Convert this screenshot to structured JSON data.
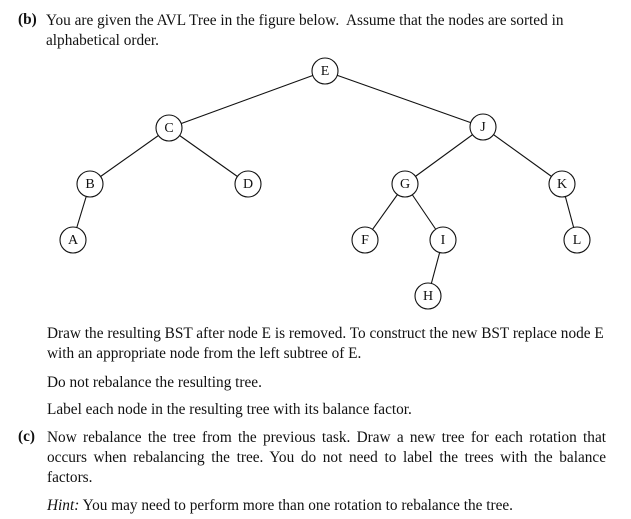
{
  "part_b": {
    "label": "(b)",
    "intro_line1": "You are given the AVL Tree in the figure below.  Assume that the nodes are sorted in",
    "intro_line2": "alphabetical order.",
    "instruction1": "Draw the resulting BST after node E is removed. To construct the new BST replace node E with an appropriate node from the left subtree of E.",
    "instruction2": "Do not rebalance the resulting tree.",
    "instruction3": "Label each node in the resulting tree with its balance factor."
  },
  "tree": {
    "nodes": [
      {
        "id": "E",
        "label": "E"
      },
      {
        "id": "C",
        "label": "C"
      },
      {
        "id": "J",
        "label": "J"
      },
      {
        "id": "B",
        "label": "B"
      },
      {
        "id": "D",
        "label": "D"
      },
      {
        "id": "G",
        "label": "G"
      },
      {
        "id": "K",
        "label": "K"
      },
      {
        "id": "A",
        "label": "A"
      },
      {
        "id": "F",
        "label": "F"
      },
      {
        "id": "I",
        "label": "I"
      },
      {
        "id": "L",
        "label": "L"
      },
      {
        "id": "H",
        "label": "H"
      }
    ],
    "edges": [
      [
        "E",
        "C"
      ],
      [
        "E",
        "J"
      ],
      [
        "C",
        "B"
      ],
      [
        "C",
        "D"
      ],
      [
        "B",
        "A"
      ],
      [
        "J",
        "G"
      ],
      [
        "J",
        "K"
      ],
      [
        "G",
        "F"
      ],
      [
        "G",
        "I"
      ],
      [
        "I",
        "H"
      ],
      [
        "K",
        "L"
      ]
    ]
  },
  "part_c": {
    "label": "(c)",
    "text": "Now rebalance the tree from the previous task.  Draw a new tree for each rotation that occurs when rebalancing the tree.  You do not need to label the trees with the balance factors.",
    "hint_label": "Hint:",
    "hint_text": "You may need to perform more than one rotation to rebalance the tree."
  }
}
